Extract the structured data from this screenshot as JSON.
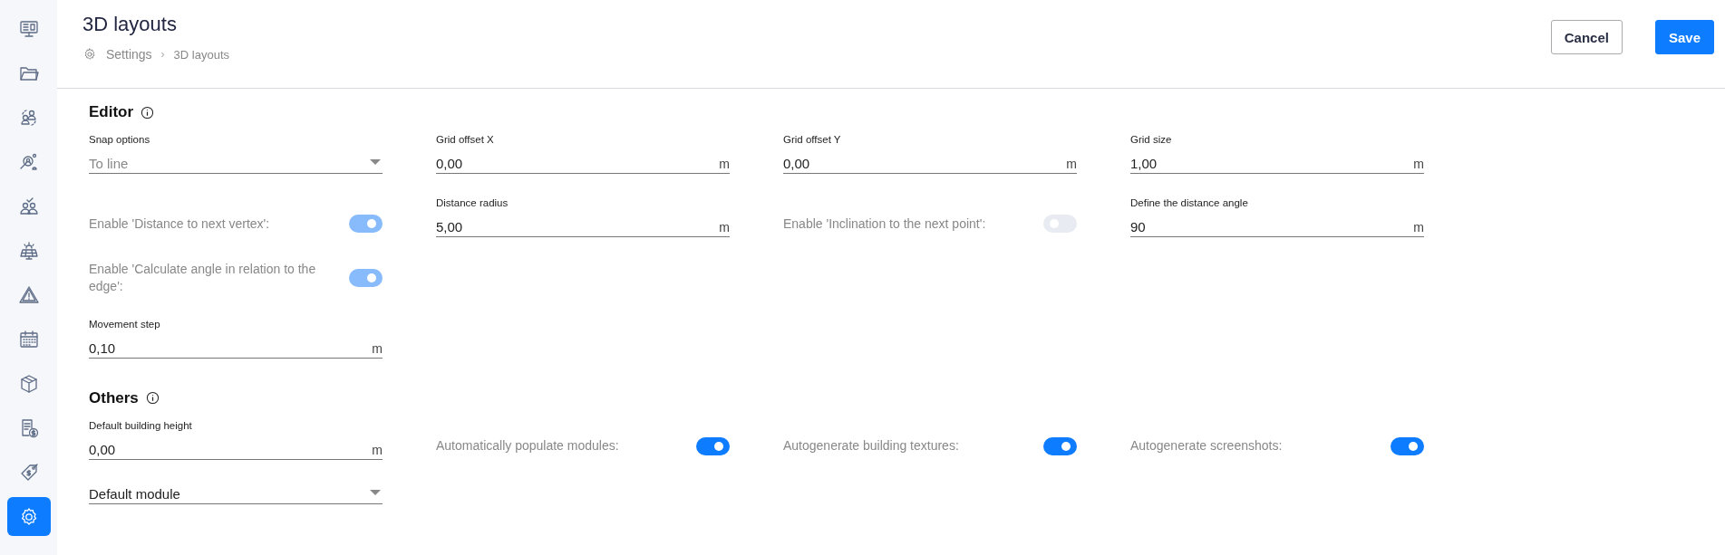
{
  "sidebar": {
    "items": [
      {
        "selected": false
      },
      {
        "selected": false
      },
      {
        "selected": false
      },
      {
        "selected": false
      },
      {
        "selected": false
      },
      {
        "selected": false
      },
      {
        "selected": false
      },
      {
        "selected": false
      },
      {
        "selected": false
      },
      {
        "selected": false
      },
      {
        "selected": false
      },
      {
        "selected": true
      }
    ]
  },
  "header": {
    "title": "3D layouts",
    "breadcrumb": [
      "Settings",
      "3D layouts"
    ],
    "separator": "›",
    "buttons": [
      {
        "label": "Cancel",
        "kind": "secondary"
      },
      {
        "label": "Save",
        "kind": "primary"
      }
    ]
  },
  "sections": [
    {
      "title": "Editor",
      "rows": [
        [
          {
            "kind": "select",
            "label": "Snap options",
            "value": "To line",
            "disabled": true
          },
          {
            "kind": "field",
            "label": "Grid offset X",
            "value": "0,00",
            "unit": "m"
          },
          {
            "kind": "field",
            "label": "Grid offset Y",
            "value": "0,00",
            "unit": "m"
          },
          {
            "kind": "field",
            "label": "Grid size",
            "value": "1,00",
            "unit": "m"
          }
        ],
        [
          {
            "kind": "toggle",
            "label": "Enable 'Distance to next vertex':",
            "on": true,
            "disabled": true
          },
          {
            "kind": "field",
            "label": "Distance radius",
            "value": "5,00",
            "unit": "m"
          },
          {
            "kind": "toggle",
            "label": "Enable 'Inclination to the next point':",
            "on": false,
            "disabled": true
          },
          {
            "kind": "field",
            "label": "Define the distance angle",
            "value": "90",
            "unit": "m"
          }
        ],
        [
          {
            "kind": "toggle",
            "label": "Enable 'Calculate angle in relation to the edge':",
            "on": true,
            "disabled": true
          }
        ],
        [
          {
            "kind": "field",
            "label": "Movement step",
            "value": "0,10",
            "unit": "m"
          }
        ]
      ]
    },
    {
      "title": "Others",
      "rows": [
        [
          {
            "kind": "field",
            "label": "Default building height",
            "value": "0,00",
            "unit": "m"
          },
          {
            "kind": "toggle",
            "label": "Automatically populate modules:",
            "on": true,
            "disabled": false
          },
          {
            "kind": "toggle",
            "label": "Autogenerate building textures:",
            "on": true,
            "disabled": false
          },
          {
            "kind": "toggle",
            "label": "Autogenerate screenshots:",
            "on": true,
            "disabled": false
          }
        ],
        [
          {
            "kind": "select",
            "value": "Default module",
            "disabled": false
          }
        ]
      ]
    }
  ]
}
